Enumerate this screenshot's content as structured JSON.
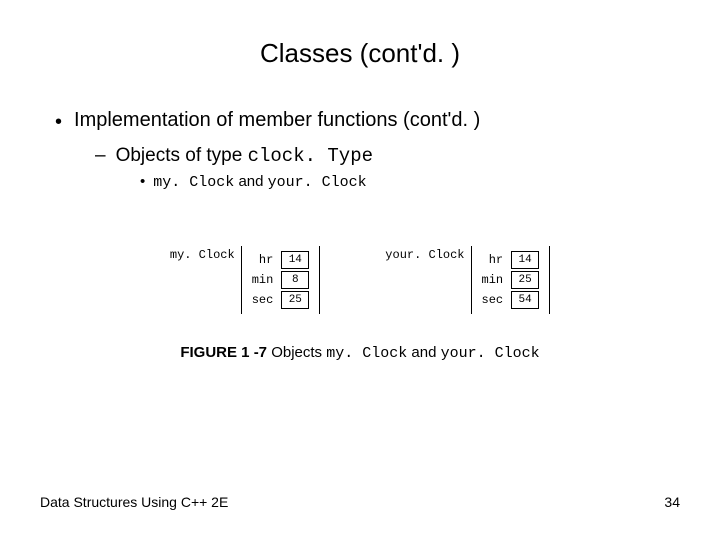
{
  "title": "Classes (cont'd. )",
  "bullets": {
    "l1": "Implementation of member functions (cont'd. )",
    "l2_prefix": "Objects of type ",
    "l2_code": "clock. Type",
    "l3_code1": "my. Clock",
    "l3_mid": " and ",
    "l3_code2": "your. Clock"
  },
  "figure": {
    "left": {
      "label": "my. Clock",
      "rows": [
        {
          "field": "hr",
          "value": "14"
        },
        {
          "field": "min",
          "value": "8"
        },
        {
          "field": "sec",
          "value": "25"
        }
      ]
    },
    "right": {
      "label": "your. Clock",
      "rows": [
        {
          "field": "hr",
          "value": "14"
        },
        {
          "field": "min",
          "value": "25"
        },
        {
          "field": "sec",
          "value": "54"
        }
      ]
    }
  },
  "caption": {
    "bold": "FIGURE 1 -7 ",
    "t1": "Objects ",
    "c1": "my. Clock",
    "t2": " and ",
    "c2": "your. Clock"
  },
  "footer": {
    "left": "Data Structures Using C++ 2E",
    "right": "34"
  }
}
